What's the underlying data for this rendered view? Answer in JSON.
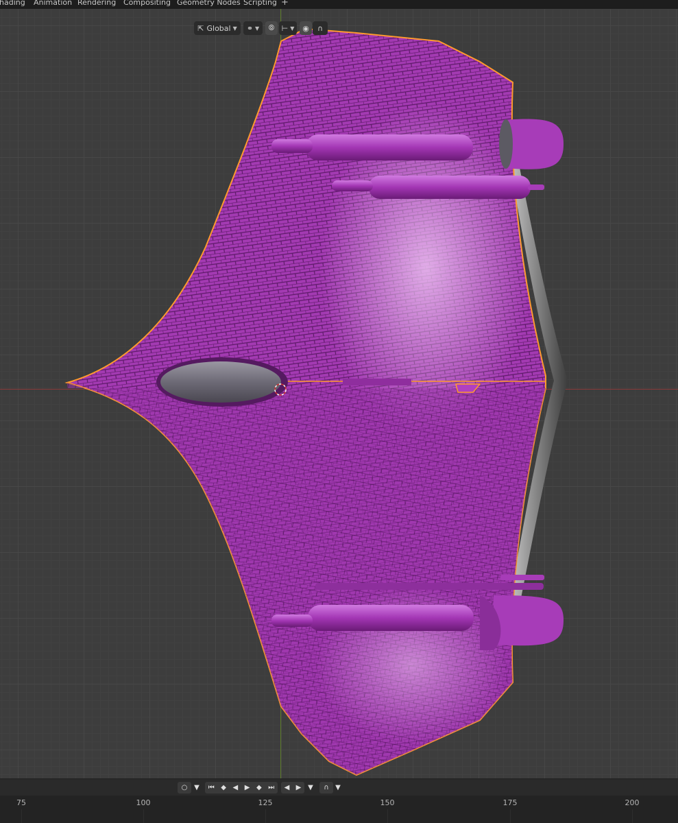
{
  "workspace_tabs": [
    "hading",
    "Animation",
    "Rendering",
    "Compositing",
    "Geometry Nodes",
    "Scripting"
  ],
  "add_workspace_label": "+",
  "header": {
    "transform_orientation": "Global",
    "icons": [
      "transform-orientation-icon",
      "pivot-icon",
      "snap-icon",
      "snap-target-icon",
      "proportional-edit-icon",
      "falloff-icon"
    ]
  },
  "viewport": {
    "object_color": "#a53cb4",
    "selection_outline": "#ff9a2e",
    "x_axis_color": "#8a3a3a",
    "y_axis_color": "#5c7a2b"
  },
  "timeline": {
    "controls": [
      "keyframe-toggle-icon",
      "jump-to-start-icon",
      "prev-keyframe-icon",
      "play-reverse-icon",
      "play-icon",
      "next-keyframe-icon",
      "jump-to-end-icon",
      "prev-frame-icon",
      "next-frame-icon",
      "keying-icon"
    ],
    "ruler_labels": [
      "75",
      "100",
      "125",
      "150",
      "175",
      "200"
    ]
  }
}
